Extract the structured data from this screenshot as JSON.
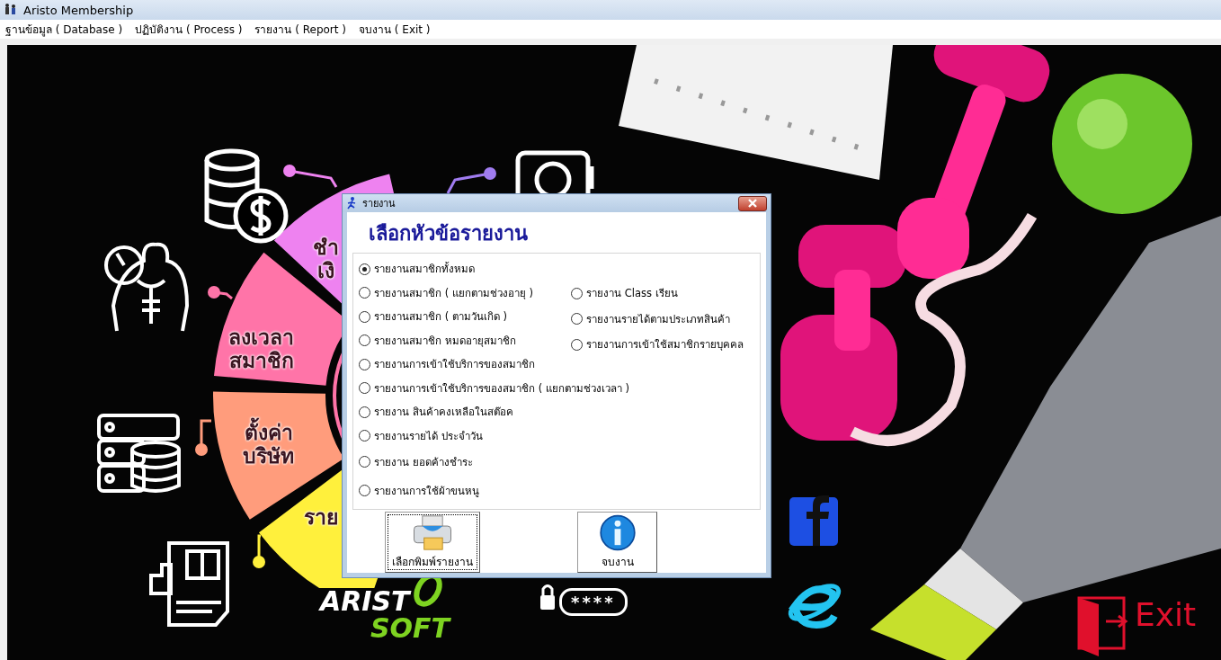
{
  "window": {
    "title": "Aristo Membership"
  },
  "menu": [
    {
      "label": "ฐานข้อมูล ( Database )"
    },
    {
      "label": "ปฏิบัติงาน ( Process )"
    },
    {
      "label": "รายงาน ( Report )"
    },
    {
      "label": "จบงาน ( Exit )"
    }
  ],
  "wheel": [
    {
      "lines": [
        "ชำ",
        "เงิ"
      ],
      "color": "#ee82f0"
    },
    {
      "lines": [
        "ลงเวลา",
        "สมาชิก"
      ],
      "color": "#ff74a8"
    },
    {
      "lines": [
        "ตั้งค่า",
        "บริษัท"
      ],
      "color": "#ff9c7c"
    },
    {
      "lines": [
        "ราย"
      ],
      "color": "#fff03c"
    }
  ],
  "logo": {
    "line_1": "ARIST",
    "line_2": "SOFT"
  },
  "password_badge": "****",
  "exit_label": "Exit",
  "dialog": {
    "title": "รายงาน",
    "heading": "เลือกหัวข้อรายงาน",
    "options_left": [
      {
        "label": "รายงานสมาชิกทั้งหมด",
        "selected": true
      },
      {
        "label": "รายงานสมาชิก ( แยกตามช่วงอายุ )",
        "selected": false
      },
      {
        "label": "รายงานสมาชิก ( ตามวันเกิด )",
        "selected": false
      },
      {
        "label": "รายงานสมาชิก หมดอายุสมาชิก",
        "selected": false
      },
      {
        "label": "รายงานการเข้าใช้บริการของสมาชิก",
        "selected": false
      },
      {
        "label": "รายงานการเข้าใช้บริการของสมาชิก ( แยกตามช่วงเวลา )",
        "selected": false
      },
      {
        "label": "รายงาน สินค้าคงเหลือในสต๊อค",
        "selected": false
      },
      {
        "label": "รายงานรายได้ ประจำวัน",
        "selected": false
      },
      {
        "label": "รายงาน ยอดค้างชำระ",
        "selected": false
      },
      {
        "label": "รายงานการใช้ผ้าขนหนู",
        "selected": false
      }
    ],
    "options_right": [
      {
        "label": "รายงาน Class เรียน",
        "selected": false
      },
      {
        "label": "รายงานรายได้ตามประเภทสินค้า",
        "selected": false
      },
      {
        "label": "รายงานการเข้าใช้สมาชิกรายบุคคล",
        "selected": false
      }
    ],
    "buttons": [
      {
        "label": "เลือกพิมพ์รายงาน",
        "kind": "print"
      },
      {
        "label": "จบงาน",
        "kind": "info"
      }
    ]
  }
}
